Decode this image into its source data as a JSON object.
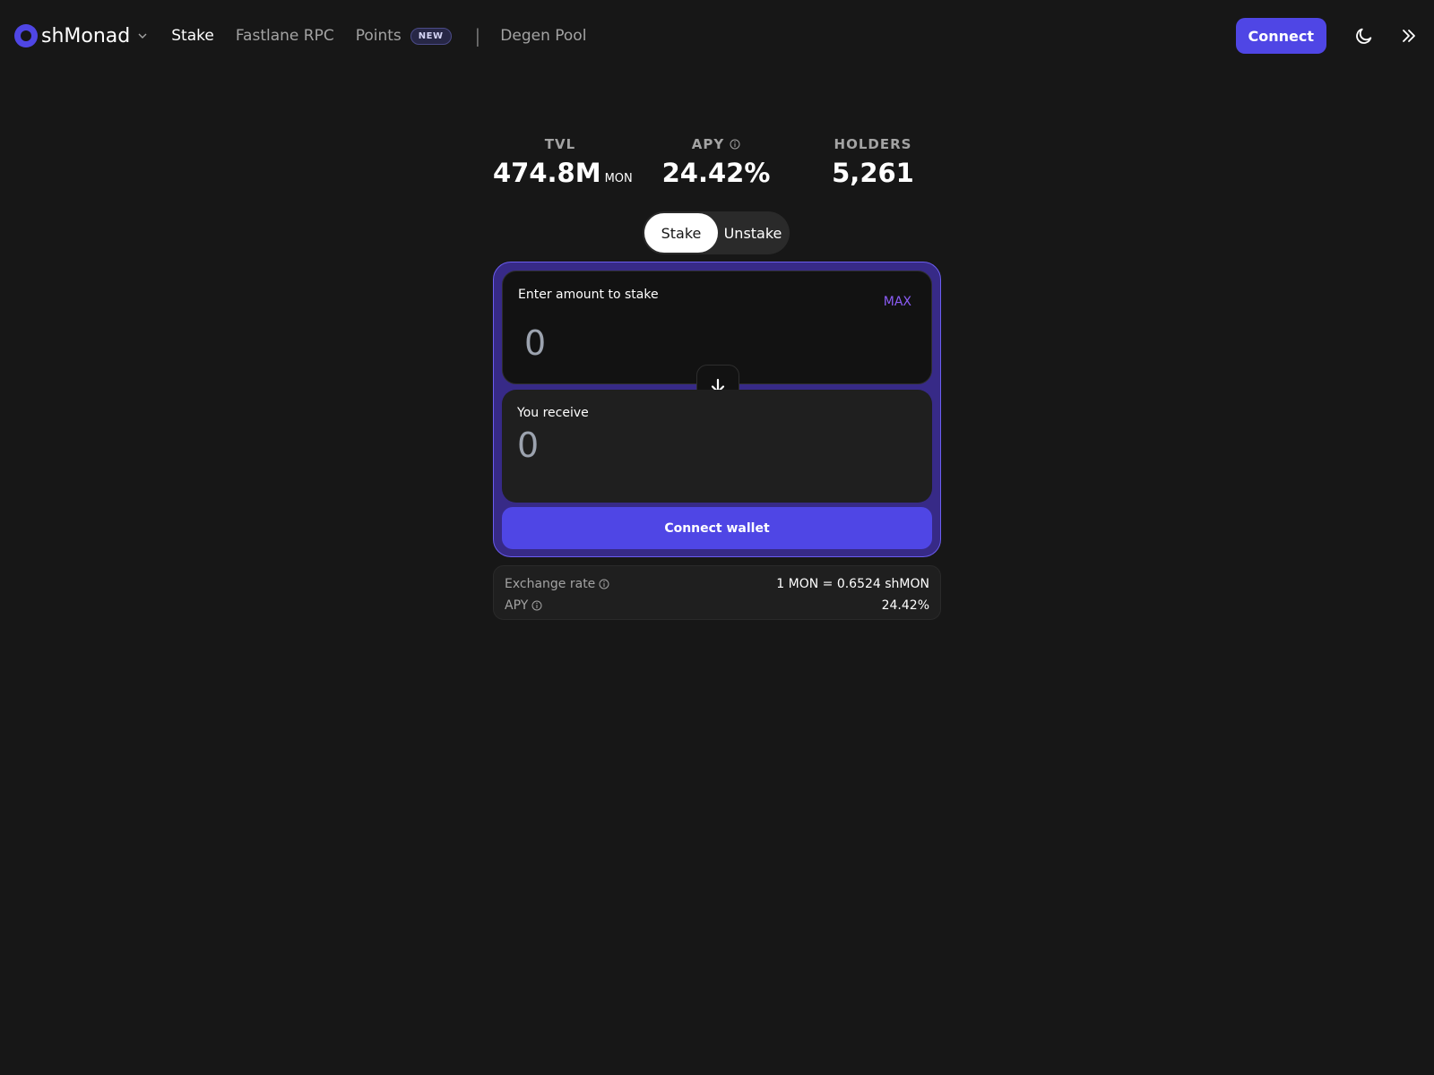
{
  "header": {
    "brand": "shMonad",
    "nav": [
      {
        "label": "Stake",
        "active": true
      },
      {
        "label": "Fastlane RPC",
        "active": false
      },
      {
        "label": "Points",
        "badge": "NEW",
        "active": false
      },
      {
        "label": "Degen Pool",
        "active": false
      }
    ],
    "separator": "|",
    "connect_label": "Connect",
    "icons": [
      "moon-icon",
      "double-chevron-right-icon"
    ]
  },
  "stats": {
    "tvl": {
      "label": "TVL",
      "value": "474.8M",
      "unit": "MON"
    },
    "apy": {
      "label": "APY",
      "value": "24.42%"
    },
    "holders": {
      "label": "HOLDERS",
      "value": "5,261"
    }
  },
  "toggle": {
    "stake": "Stake",
    "unstake": "Unstake",
    "selected": "Stake"
  },
  "stake_card": {
    "input_label": "Enter amount to stake",
    "max_label": "MAX",
    "input_placeholder": "0",
    "receive_label": "You receive",
    "receive_value": "0",
    "button_label": "Connect wallet"
  },
  "info": {
    "exchange_rate_label": "Exchange rate",
    "exchange_rate_value": "1 MON = 0.6524 shMON",
    "apy_label": "APY",
    "apy_value": "24.42%"
  },
  "colors": {
    "background": "#171717",
    "accent": "#4f46e5",
    "card_border": "#6b5df0",
    "max_link": "#8b5cf6"
  }
}
